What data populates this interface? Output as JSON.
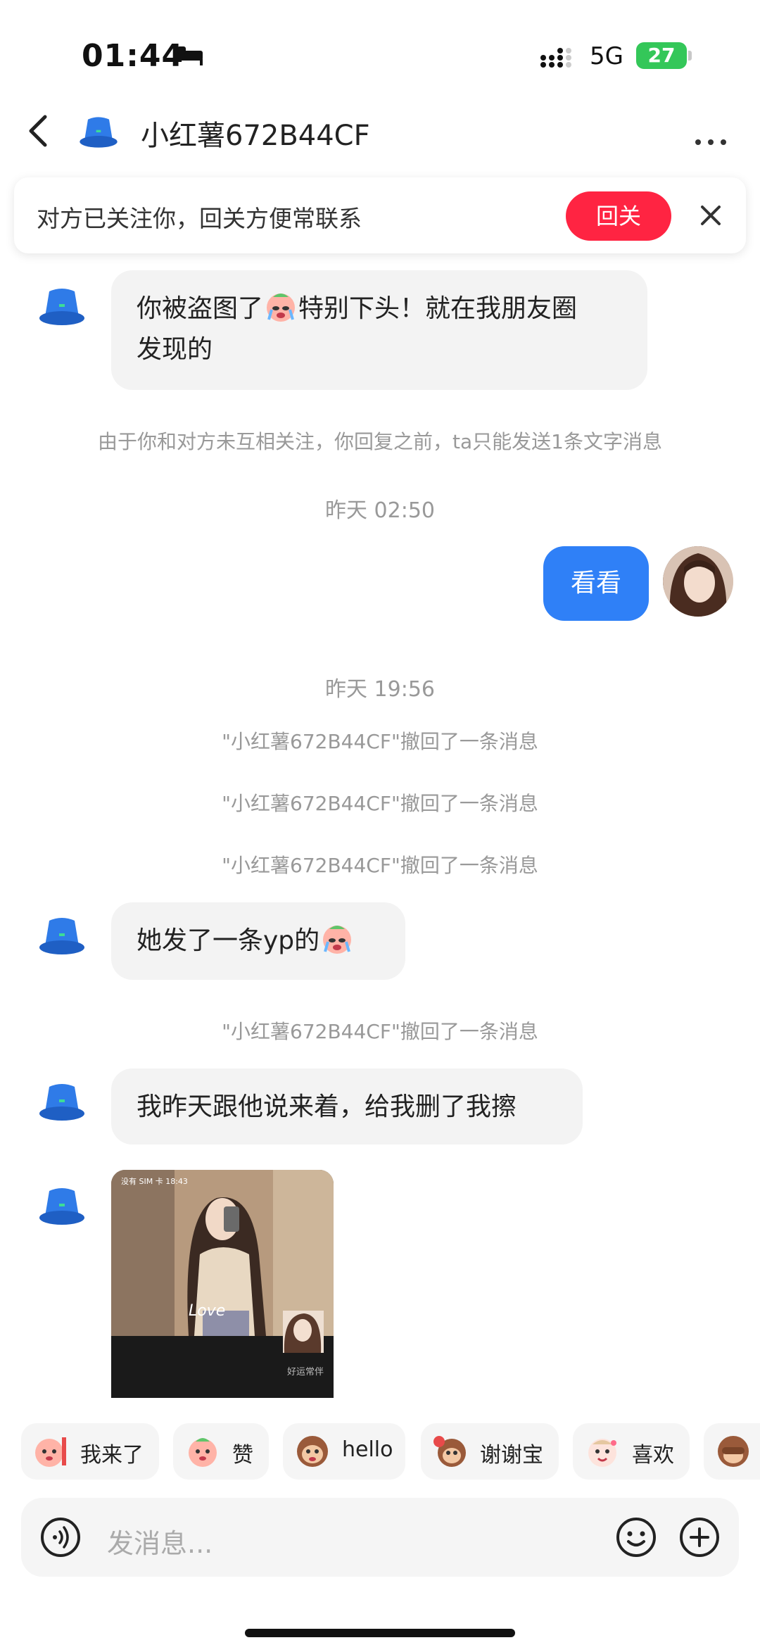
{
  "status": {
    "time": "01:44",
    "network": "5G",
    "battery": "27"
  },
  "header": {
    "contact_name": "小红薯672B44CF"
  },
  "banner": {
    "text": "对方已关注你，回关方便常联系",
    "follow_label": "回关"
  },
  "messages": {
    "m1": {
      "line1": "你被盗图了",
      "line1b": "特别下头！就在我朋友圈",
      "line2": "发现的"
    },
    "sys_limit": "由于你和对方未互相关注，你回复之前，ta只能发送1条文字消息",
    "stamp1": "昨天 02:50",
    "mine1": "看看",
    "stamp2": "昨天 19:56",
    "recall": "\"小红薯672B44CF\"撤回了一条消息",
    "m2": "她发了一条yp的",
    "m3": "我昨天跟他说来着，给我删了我擦",
    "photo": {
      "status_left": "没有 SIM 卡 18:43",
      "watermark": "好运常伴",
      "caption": "Love"
    }
  },
  "quick_replies": [
    "我来了",
    "赞",
    "hello",
    "谢谢宝",
    "喜欢"
  ],
  "input": {
    "placeholder": "发消息..."
  },
  "colors": {
    "accent_red": "#ff2442",
    "bubble_blue": "#2f80f7",
    "bubble_gray": "#f3f3f3"
  }
}
